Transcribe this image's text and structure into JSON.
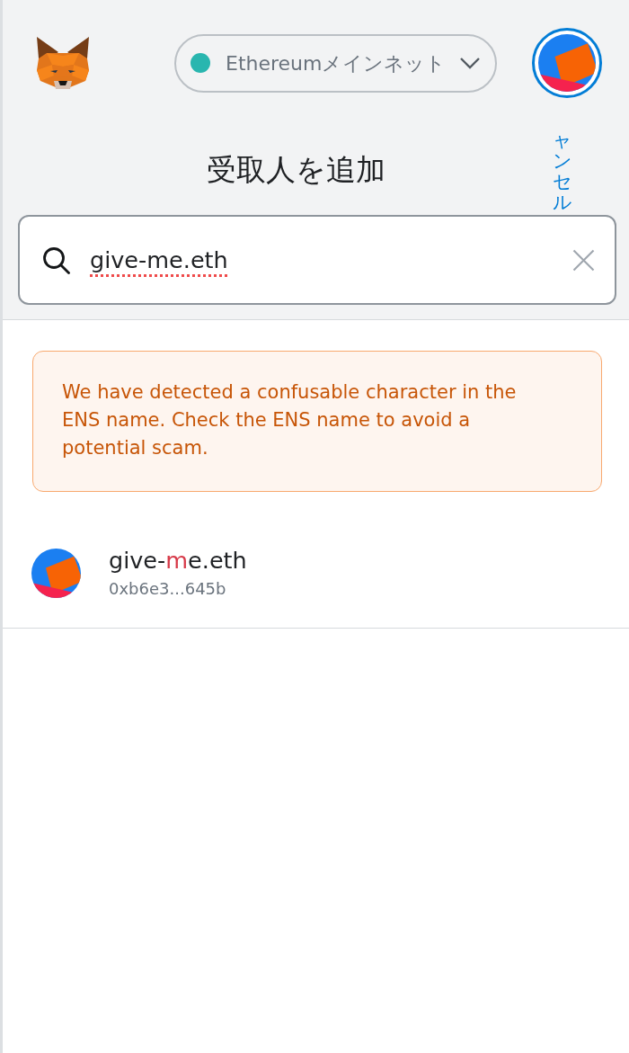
{
  "header": {
    "network": {
      "label": "Ethereumメインネット"
    }
  },
  "page": {
    "title": "受取人を追加",
    "cancel": "ャンセル"
  },
  "search": {
    "value": "give-me.eth",
    "spellcheck_flagged": true
  },
  "warning": {
    "message": "We have detected a confusable character in the ENS name. Check the ENS name to avoid a potential scam."
  },
  "recipients": [
    {
      "name_parts": [
        {
          "text": "give-",
          "confusable": false
        },
        {
          "text": "m",
          "confusable": true
        },
        {
          "text": "e.eth",
          "confusable": false
        }
      ],
      "address": "0xb6e3...645b"
    }
  ]
}
